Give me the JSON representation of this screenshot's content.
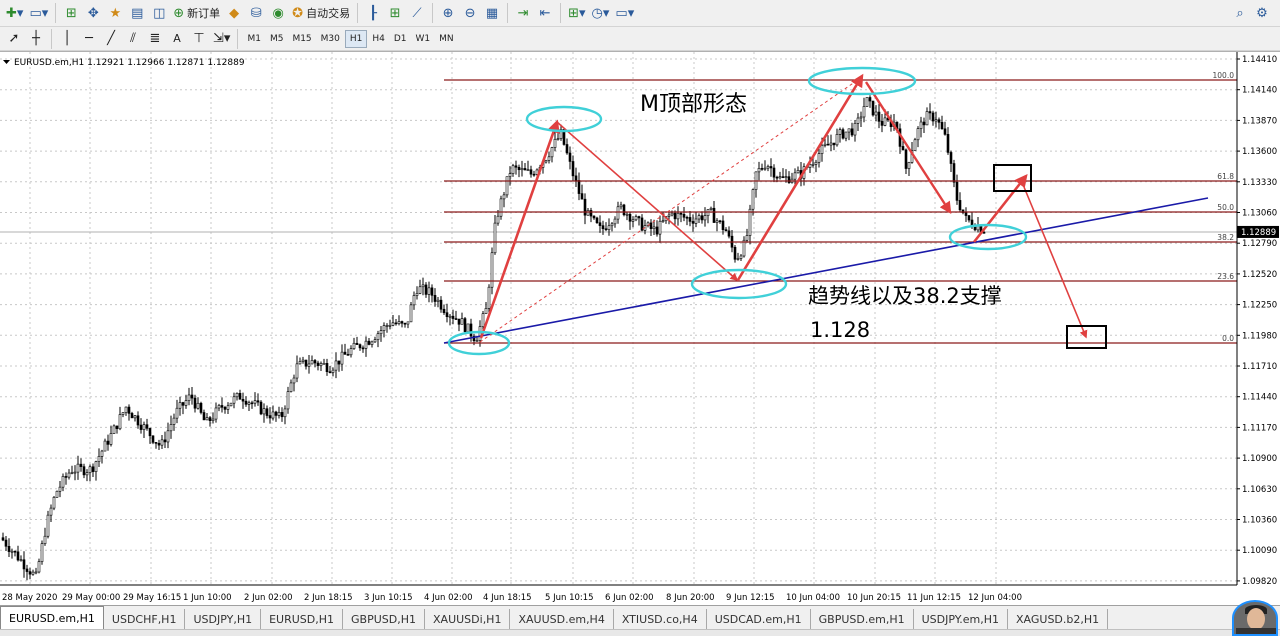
{
  "toolbar1": {
    "new_order_label": "新订单",
    "auto_trading_label": "自动交易",
    "icons": [
      "new-chart-icon",
      "profiles-icon",
      "market-watch-icon",
      "navigator-icon",
      "favorites-icon",
      "terminal-icon",
      "tester-icon",
      "new-order-icon",
      "metaeditor-icon",
      "signals-icon",
      "chart-globe-icon",
      "auto-trading-icon",
      "bar-chart-icon",
      "candlestick-icon",
      "line-chart-icon",
      "zoom-in-icon",
      "zoom-out-icon",
      "tile-windows-icon",
      "autoscroll-icon",
      "chart-shift-icon",
      "indicators-icon",
      "period-icon",
      "templates-icon",
      "search-icon",
      "settings-icon"
    ]
  },
  "toolbar2": {
    "tool_icons": [
      "cursor-icon",
      "crosshair-icon",
      "vertical-line-icon",
      "horizontal-line-icon",
      "trendline-icon",
      "equidistant-channel-icon",
      "fibo-icon",
      "text-icon",
      "text-label-icon",
      "arrows-icon"
    ],
    "text_tool_label": "A",
    "timeframes": [
      "M1",
      "M5",
      "M15",
      "M30",
      "H1",
      "H4",
      "D1",
      "W1",
      "MN"
    ],
    "active_timeframe": "H1"
  },
  "chart": {
    "header": "EURUSD.em,H1  1.12921 1.12966 1.12871 1.12889",
    "price_labels": [
      "1.14410",
      "1.14140",
      "1.13870",
      "1.13600",
      "1.13330",
      "1.13060",
      "1.12790",
      "1.12520",
      "1.12250",
      "1.11980",
      "1.11710",
      "1.11440",
      "1.11170",
      "1.10900",
      "1.10630",
      "1.10360",
      "1.10090",
      "1.09820"
    ],
    "current_price": "1.12889",
    "time_labels": [
      "28 May 2020",
      "29 May 00:00",
      "29 May 16:15",
      "1 Jun 10:00",
      "2 Jun 02:00",
      "2 Jun 18:15",
      "3 Jun 10:15",
      "4 Jun 02:00",
      "4 Jun 18:15",
      "5 Jun 10:15",
      "6 Jun 02:00",
      "8 Jun 20:00",
      "9 Jun 12:15",
      "10 Jun 04:00",
      "10 Jun 20:15",
      "11 Jun 12:15",
      "12 Jun 04:00"
    ],
    "fibo_levels": [
      "100.0",
      "61.8",
      "50.0",
      "38.2",
      "23.6",
      "0.0"
    ],
    "annotation_title": "M顶部形态",
    "annotation_support_line1": "趋势线以及38.2支撑",
    "annotation_support_line2": "1.128",
    "colors": {
      "fibo": "#8b1a1a",
      "trendline": "#1a1aa8",
      "arrow": "#e04040",
      "ellipse": "#40d0d8",
      "candle": "#000000"
    }
  },
  "tabs": [
    "EURUSD.em,H1",
    "USDCHF,H1",
    "USDJPY,H1",
    "EURUSD,H1",
    "GBPUSD,H1",
    "XAUUSDi,H1",
    "XAUUSD.em,H4",
    "XTIUSD.co,H4",
    "USDCAD.em,H1",
    "GBPUSD.em,H1",
    "USDJPY.em,H1",
    "XAGUSD.b2,H1"
  ],
  "active_tab": "EURUSD.em,H1"
}
